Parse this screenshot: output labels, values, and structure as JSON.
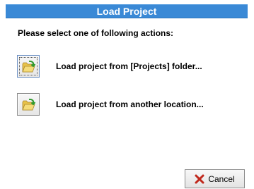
{
  "dialog": {
    "title": "Load Project",
    "prompt": "Please select one of following actions:"
  },
  "actions": [
    {
      "label": "Load project from [Projects] folder...",
      "icon": "open-folder-icon"
    },
    {
      "label": "Load project from another location...",
      "icon": "open-folder-icon"
    }
  ],
  "footer": {
    "cancel_label": "Cancel",
    "cancel_icon": "x-icon"
  },
  "colors": {
    "title_bar": "#3a89d6",
    "folder": "#f2d163",
    "arrow": "#2e9a2e",
    "cancel_x": "#c0281c"
  }
}
